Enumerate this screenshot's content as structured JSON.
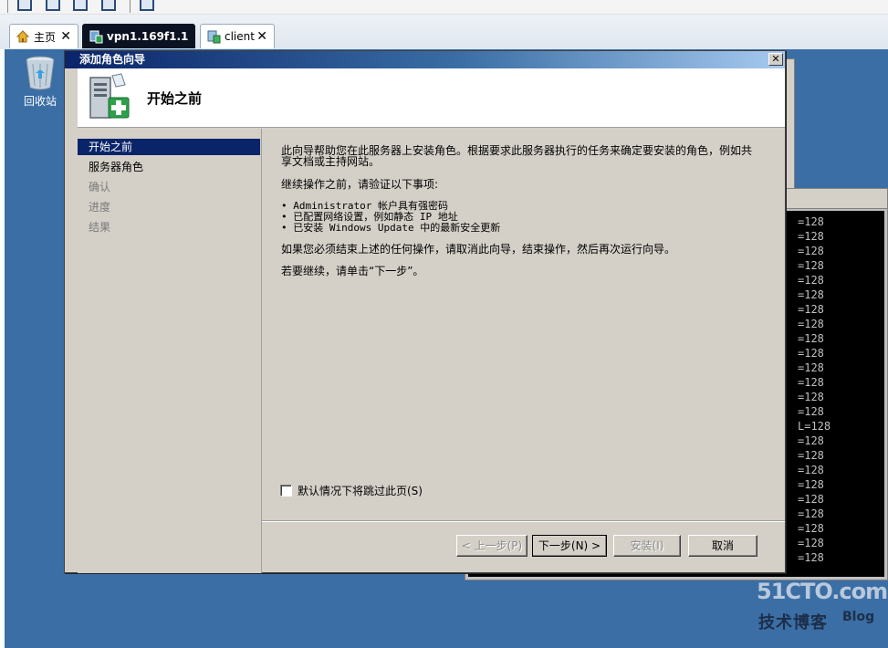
{
  "tabs": [
    {
      "label": "主页",
      "icon": "home-icon"
    },
    {
      "label": "vpn1.169f1.1",
      "icon": "vm-icon"
    },
    {
      "label": "client",
      "icon": "vm-icon"
    }
  ],
  "tab_close_glyph": "✕",
  "desktop": {
    "recycle_bin_label": "回收站"
  },
  "console": {
    "lines": [
      "=128",
      "=128",
      "=128",
      "=128",
      "=128",
      "=128",
      "=128",
      "=128",
      "=128",
      "=128",
      "=128",
      "=128",
      "=128",
      "=128",
      "L=128",
      "=128",
      "=128",
      "=128",
      "=128",
      "=128",
      "=128",
      "=128",
      "=128",
      "=128"
    ]
  },
  "wizard": {
    "title": "添加角色向导",
    "close_glyph": "✕",
    "header_title": "开始之前",
    "nav": [
      {
        "label": "开始之前",
        "state": "active"
      },
      {
        "label": "服务器角色",
        "state": "done"
      },
      {
        "label": "确认",
        "state": "pending"
      },
      {
        "label": "进度",
        "state": "pending"
      },
      {
        "label": "结果",
        "state": "pending"
      }
    ],
    "content": {
      "intro_line1": "此向导帮助您在此服务器上安装角色。根据要求此服务器执行的任务来确定要安装的角色，例如共",
      "intro_line2": "享文档或主持网站。",
      "verify_heading": "继续操作之前，请验证以下事项:",
      "bullets": [
        "• Administrator 帐户具有强密码",
        "• 已配置网络设置，例如静态 IP 地址",
        "• 已安装 Windows Update 中的最新安全更新"
      ],
      "cancel_note": "如果您必须结束上述的任何操作，请取消此向导，结束操作，然后再次运行向导。",
      "continue_note": "若要继续，请单击“下一步”。"
    },
    "skip_checkbox_label": "默认情况下将跳过此页(S)",
    "buttons": {
      "prev": "< 上一步(P)",
      "next": "下一步(N) >",
      "install": "安装(I)",
      "cancel": "取消"
    }
  },
  "watermark": {
    "site": "51CTO.com",
    "sub": "技术博客",
    "blog": "Blog"
  },
  "colors": {
    "desktop": "#3a6ea5",
    "title_gradient_start": "#0a246a",
    "selected_nav": "#0a246a",
    "dialog_face": "#d4d0c8"
  }
}
